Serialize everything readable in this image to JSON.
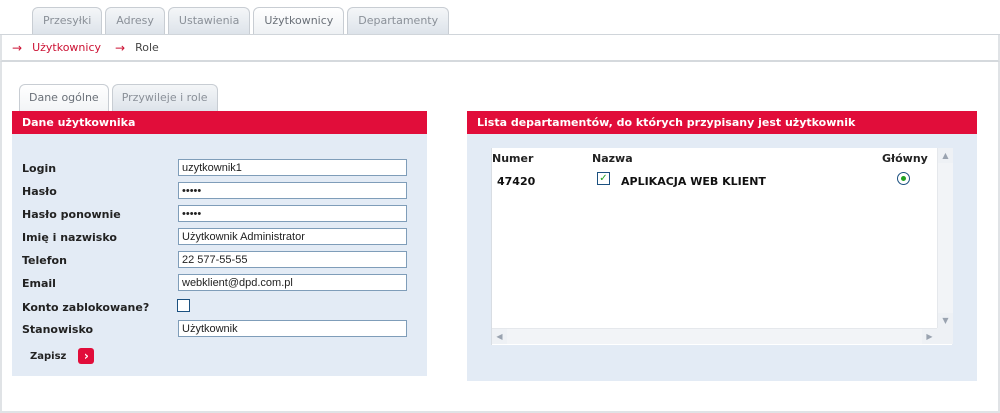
{
  "top_tabs": [
    {
      "label": "Przesyłki"
    },
    {
      "label": "Adresy"
    },
    {
      "label": "Ustawienia"
    },
    {
      "label": "Użytkownicy",
      "active": true
    },
    {
      "label": "Departamenty"
    }
  ],
  "breadcrumb": [
    {
      "label": "Użytkownicy"
    },
    {
      "label": "Role"
    }
  ],
  "inner_tabs": [
    {
      "label": "Dane ogólne"
    },
    {
      "label": "Przywileje i role"
    }
  ],
  "user_panel": {
    "title": "Dane użytkownika",
    "fields": {
      "login": {
        "label": "Login",
        "value": "uzytkownik1"
      },
      "password": {
        "label": "Hasło",
        "value": "•••••"
      },
      "password_repeat": {
        "label": "Hasło ponownie",
        "value": "•••••"
      },
      "full_name": {
        "label": "Imię i nazwisko",
        "value": "Użytkownik Administrator"
      },
      "phone": {
        "label": "Telefon",
        "value": "22 577-55-55"
      },
      "email": {
        "label": "Email",
        "value": "webklient@dpd.com.pl"
      },
      "blocked": {
        "label": "Konto zablokowane?",
        "checked": false
      },
      "position": {
        "label": "Stanowisko",
        "value": "Użytkownik"
      }
    },
    "save_label": "Zapisz",
    "save_icon": "arrow-right-icon"
  },
  "dept_panel": {
    "title": "Lista departamentów, do których przypisany jest użytkownik",
    "columns": {
      "number": "Numer",
      "name": "Nazwa",
      "main": "Główny"
    },
    "rows": [
      {
        "number": "47420",
        "assigned": true,
        "name": "APLIKACJA WEB KLIENT",
        "main": true
      }
    ]
  },
  "colors": {
    "accent": "#e10d3a",
    "panel_bg": "#e3ebf5",
    "breadcrumb_active": "#cc1133"
  }
}
